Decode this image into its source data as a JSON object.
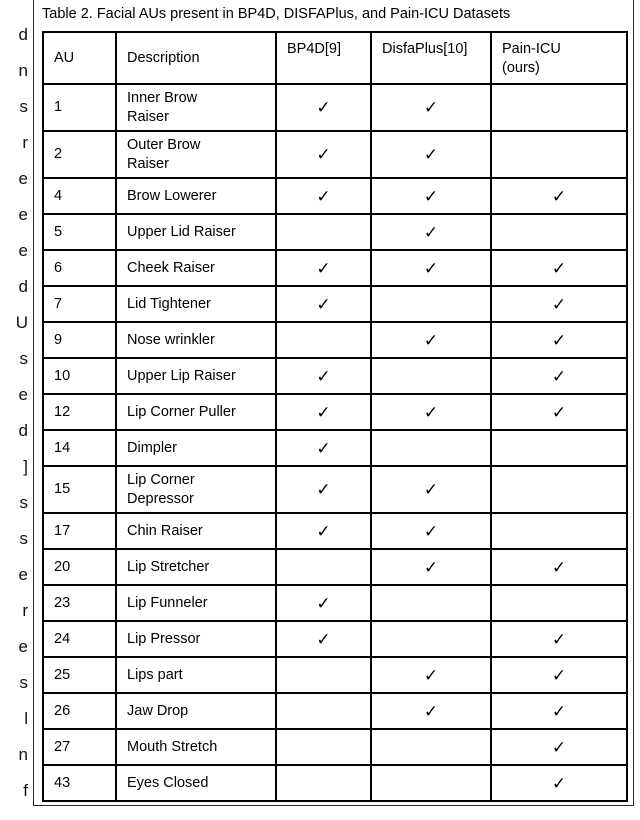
{
  "page": {
    "left_gutter_fragments": [
      "d",
      "n",
      "s",
      "r",
      "e",
      "e",
      "e",
      "d",
      "U",
      "s",
      "e",
      "d",
      "]",
      "s",
      "s",
      "e",
      "r",
      "e",
      "s",
      "l",
      "n",
      "f"
    ]
  },
  "figure": {
    "caption": "Table 2. Facial AUs present in BP4D, DISFAPlus, and Pain-ICU Datasets",
    "check_glyph": "✓"
  },
  "chart_data": {
    "type": "table",
    "title": "Table 2. Facial AUs present in BP4D, DISFAPlus, and Pain-ICU Datasets",
    "columns": [
      "AU",
      "Description",
      "BP4D[9]",
      "DisfaPlus[10]",
      "Pain-ICU (ours)"
    ],
    "column_headers": {
      "au": "AU",
      "description": "Description",
      "bp4d": "BP4D[9]",
      "disfaplus": "DisfaPlus[10]",
      "painicu_line1": "Pain-ICU",
      "painicu_line2": "(ours)"
    },
    "rows": [
      {
        "au": "1",
        "desc_line1": "Inner Brow",
        "desc_line2": "Raiser",
        "bp4d": "✓",
        "disfaplus": "✓",
        "painicu": ""
      },
      {
        "au": "2",
        "desc_line1": "Outer Brow",
        "desc_line2": "Raiser",
        "bp4d": "✓",
        "disfaplus": "✓",
        "painicu": ""
      },
      {
        "au": "4",
        "desc_line1": "Brow Lowerer",
        "desc_line2": "",
        "bp4d": "✓",
        "disfaplus": "✓",
        "painicu": "✓"
      },
      {
        "au": "5",
        "desc_line1": "Upper Lid Raiser",
        "desc_line2": "",
        "bp4d": "",
        "disfaplus": "✓",
        "painicu": ""
      },
      {
        "au": "6",
        "desc_line1": "Cheek Raiser",
        "desc_line2": "",
        "bp4d": "✓",
        "disfaplus": "✓",
        "painicu": "✓"
      },
      {
        "au": "7",
        "desc_line1": "Lid Tightener",
        "desc_line2": "",
        "bp4d": "✓",
        "disfaplus": "",
        "painicu": "✓"
      },
      {
        "au": "9",
        "desc_line1": "Nose wrinkler",
        "desc_line2": "",
        "bp4d": "",
        "disfaplus": "✓",
        "painicu": "✓"
      },
      {
        "au": "10",
        "desc_line1": "Upper Lip Raiser",
        "desc_line2": "",
        "bp4d": "✓",
        "disfaplus": "",
        "painicu": "✓"
      },
      {
        "au": "12",
        "desc_line1": "Lip Corner Puller",
        "desc_line2": "",
        "bp4d": "✓",
        "disfaplus": "✓",
        "painicu": "✓"
      },
      {
        "au": "14",
        "desc_line1": "Dimpler",
        "desc_line2": "",
        "bp4d": "✓",
        "disfaplus": "",
        "painicu": ""
      },
      {
        "au": "15",
        "desc_line1": "Lip Corner",
        "desc_line2": "Depressor",
        "bp4d": "✓",
        "disfaplus": "✓",
        "painicu": ""
      },
      {
        "au": "17",
        "desc_line1": "Chin Raiser",
        "desc_line2": "",
        "bp4d": "✓",
        "disfaplus": "✓",
        "painicu": ""
      },
      {
        "au": "20",
        "desc_line1": "Lip Stretcher",
        "desc_line2": "",
        "bp4d": "",
        "disfaplus": "✓",
        "painicu": "✓"
      },
      {
        "au": "23",
        "desc_line1": "Lip Funneler",
        "desc_line2": "",
        "bp4d": "✓",
        "disfaplus": "",
        "painicu": ""
      },
      {
        "au": "24",
        "desc_line1": "Lip Pressor",
        "desc_line2": "",
        "bp4d": "✓",
        "disfaplus": "",
        "painicu": "✓"
      },
      {
        "au": "25",
        "desc_line1": "Lips part",
        "desc_line2": "",
        "bp4d": "",
        "disfaplus": "✓",
        "painicu": "✓"
      },
      {
        "au": "26",
        "desc_line1": "Jaw Drop",
        "desc_line2": "",
        "bp4d": "",
        "disfaplus": "✓",
        "painicu": "✓"
      },
      {
        "au": "27",
        "desc_line1": "Mouth Stretch",
        "desc_line2": "",
        "bp4d": "",
        "disfaplus": "",
        "painicu": "✓"
      },
      {
        "au": "43",
        "desc_line1": "Eyes Closed",
        "desc_line2": "",
        "bp4d": "",
        "disfaplus": "",
        "painicu": "✓"
      }
    ]
  }
}
